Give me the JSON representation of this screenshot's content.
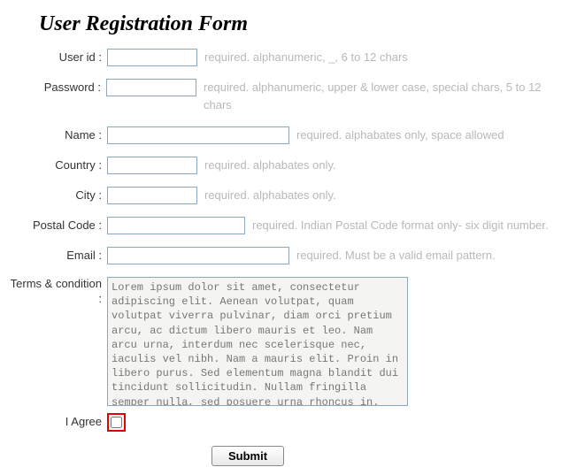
{
  "title": "User Registration Form",
  "fields": {
    "user_id": {
      "label": "User id :",
      "hint": "required. alphanumeric, _, 6 to 12 chars"
    },
    "password": {
      "label": "Password :",
      "hint": "required. alphanumeric, upper & lower case, special chars, 5 to 12 chars"
    },
    "name": {
      "label": "Name :",
      "hint": "required. alphabates only, space allowed"
    },
    "country": {
      "label": "Country :",
      "hint": "required. alphabates only."
    },
    "city": {
      "label": "City :",
      "hint": "required. alphabates only."
    },
    "postal": {
      "label": "Postal Code :",
      "hint": "required. Indian Postal Code format only- six digit number."
    },
    "email": {
      "label": "Email :",
      "hint": "required. Must be a valid email pattern."
    },
    "terms": {
      "label": "Terms & condition :",
      "value": "Lorem ipsum dolor sit amet, consectetur adipiscing elit. Aenean volutpat, quam volutpat viverra pulvinar, diam orci pretium arcu, ac dictum libero mauris et leo. Nam arcu urna, interdum nec scelerisque nec, iaculis vel nibh. Nam a mauris elit. Proin in libero purus. Sed elementum magna blandit dui tincidunt sollicitudin. Nullam fringilla semper nulla, sed posuere urna rhoncus in. Sed tempor aliquam lorem ac posuere."
    },
    "agree": {
      "label": "I Agree"
    }
  },
  "submit_label": "Submit"
}
